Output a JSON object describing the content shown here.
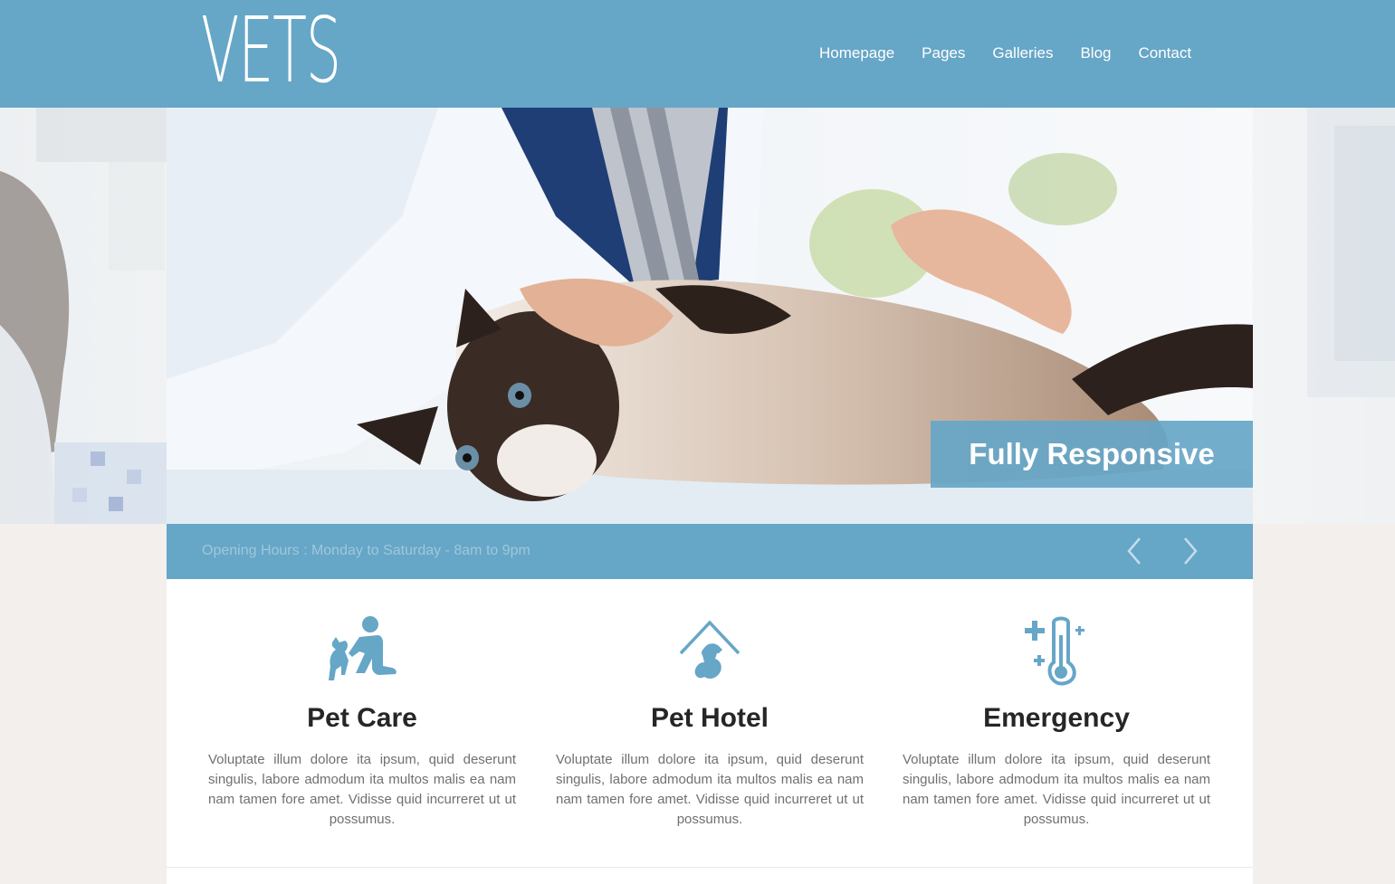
{
  "header": {
    "logo": "VETS",
    "nav": [
      {
        "label": "Homepage"
      },
      {
        "label": "Pages"
      },
      {
        "label": "Galleries"
      },
      {
        "label": "Blog"
      },
      {
        "label": "Contact"
      }
    ],
    "background": "#66a6c7"
  },
  "slider": {
    "caption": "Fully Responsive",
    "hours": "Opening Hours : Monday to Saturday - 8am to 9pm",
    "prev_icon": "chevron-left-icon",
    "next_icon": "chevron-right-icon"
  },
  "features": [
    {
      "icon": "pet-care-icon",
      "title": "Pet Care",
      "text": "Voluptate illum dolore ita ipsum, quid deserunt singulis, labore admodum ita multos malis ea nam nam tamen fore amet. Vidisse quid incurreret ut ut possumus."
    },
    {
      "icon": "pet-hotel-icon",
      "title": "Pet Hotel",
      "text": "Voluptate illum dolore ita ipsum, quid deserunt singulis, labore admodum ita multos malis ea nam nam tamen fore amet. Vidisse quid incurreret ut ut possumus."
    },
    {
      "icon": "thermometer-icon",
      "title": "Emergency",
      "text": "Voluptate illum dolore ita ipsum, quid deserunt singulis, labore admodum ita multos malis ea nam nam tamen fore amet. Vidisse quid incurreret ut ut possumus."
    }
  ],
  "colors": {
    "accent": "#66a6c7",
    "heading": "#262626",
    "body_text": "#707070",
    "page_bg": "#f3efed"
  }
}
